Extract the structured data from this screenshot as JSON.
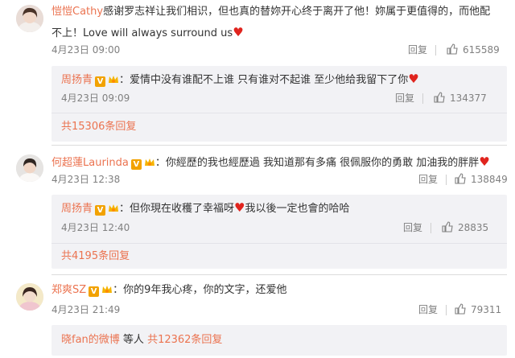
{
  "comments": [
    {
      "name": "愷愷Cathy",
      "text_line1": "感谢罗志祥让我们相识，但也真的替妳开心终于离开了他！妳属于更值得的，而他配",
      "text_line2": "不上！Love will always surround us",
      "date": "4月23日 09:00",
      "reply_label": "回复",
      "likes": "615589",
      "reply": {
        "name": "周扬青",
        "text": "：爱情中没有谁配不上谁 只有谁对不起谁 至少他给我留下了你",
        "date": "4月23日 09:09",
        "reply_label": "回复",
        "likes": "134377"
      },
      "reply_count": "共15306条回复"
    },
    {
      "name": "何超蓮Laurinda",
      "text": "：你經歷的我也經歷過 我知道那有多痛 很佩服你的勇敢 加油我的胖胖",
      "date": "4月23日 12:38",
      "reply_label": "回复",
      "likes": "138849",
      "reply": {
        "name": "周扬青",
        "text_a": "：但你現在收穫了幸福呀",
        "text_b": "我以後一定也會的哈哈",
        "date": "4月23日 12:40",
        "reply_label": "回复",
        "likes": "28835"
      },
      "reply_count": "共4195条回复"
    },
    {
      "name": "郑爽SZ",
      "text": "：你的9年我心疼，你的文字，还爱他",
      "date": "4月23日 21:49",
      "reply_label": "回复",
      "likes": "79311",
      "reply_summary_name": "晓fan的微博",
      "reply_summary_text": " 等人 ",
      "reply_count": "共12362条回复"
    }
  ],
  "badges": {
    "v": "V"
  },
  "icons": {
    "heart": "♥",
    "like": "thumbs-up-icon",
    "crown": "crown-icon"
  },
  "colors": {
    "name": "#eb7350",
    "meta": "#808080",
    "reply_bg": "#f2f2f5",
    "heart": "#e0241e",
    "v_badge": "#f2a200"
  }
}
